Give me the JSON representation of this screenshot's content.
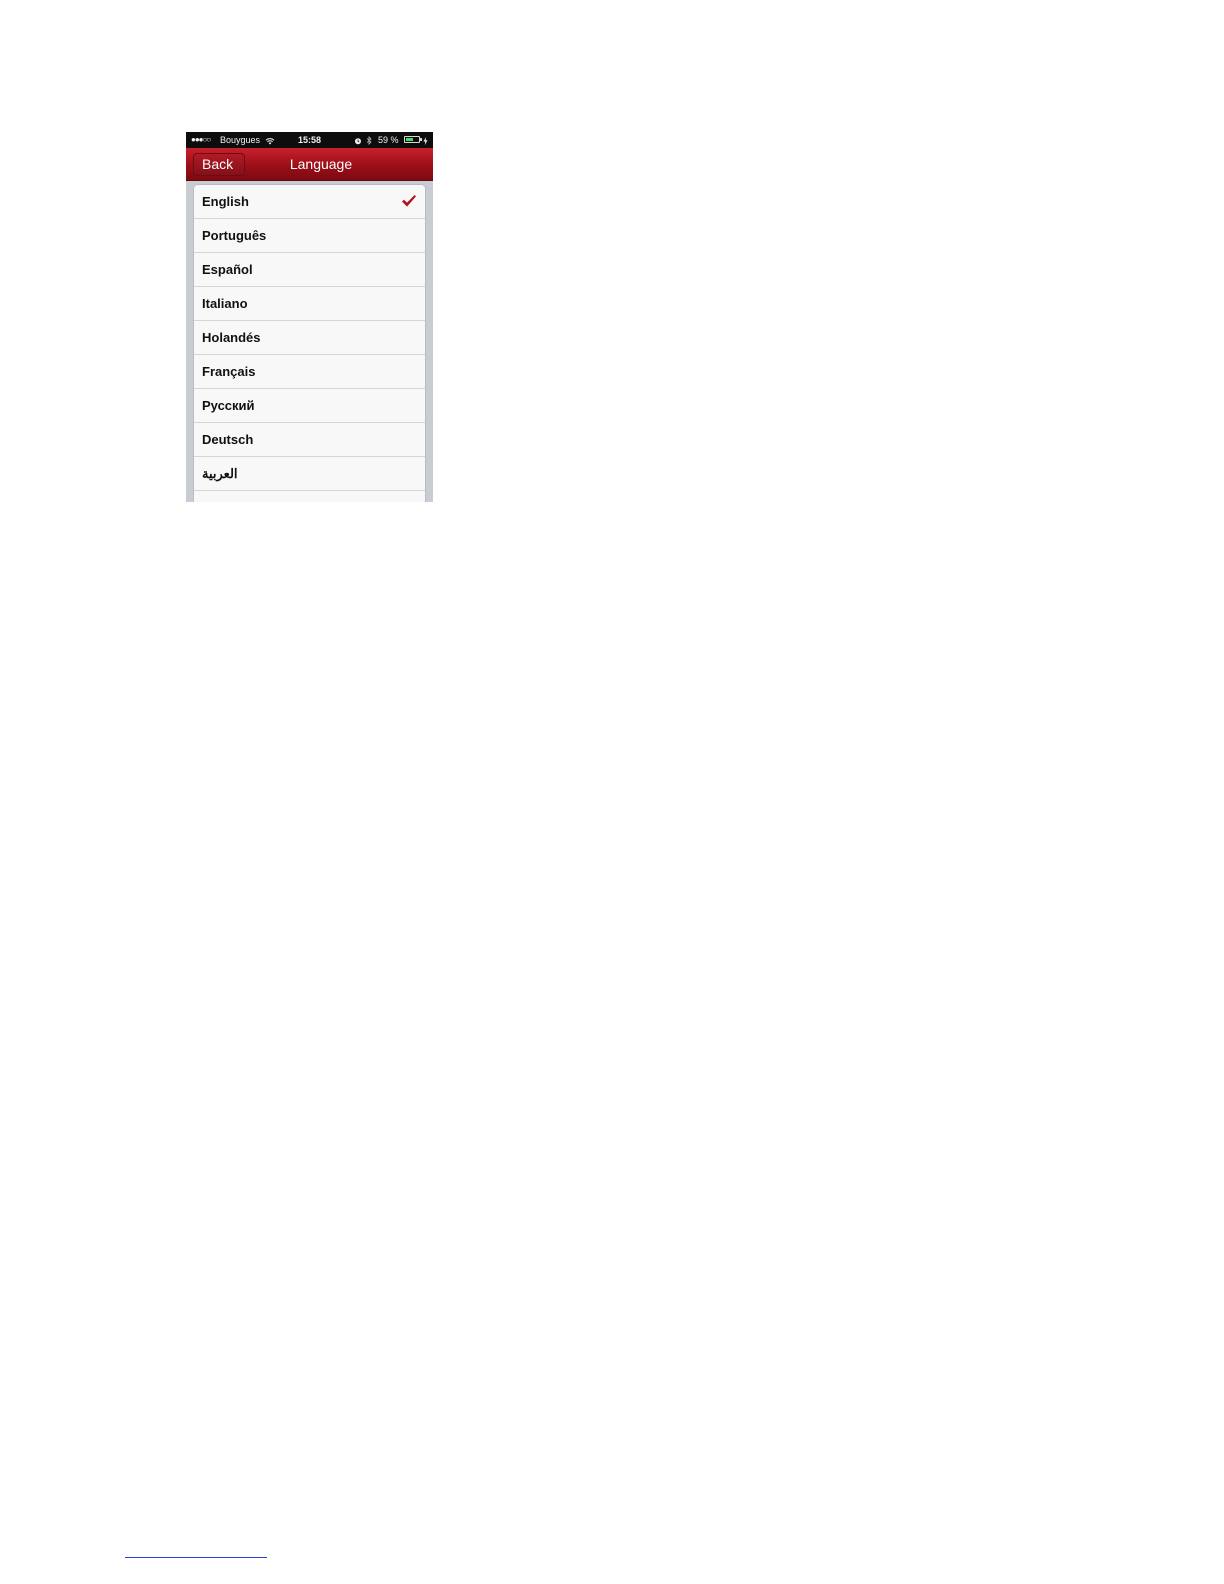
{
  "status_bar": {
    "signal": "●●●○○",
    "carrier": "Bouygues",
    "time": "15:58",
    "battery_percent": "59 %",
    "battery_level": 0.59
  },
  "nav": {
    "back_label": "Back",
    "title": "Language"
  },
  "languages": [
    {
      "label": "English",
      "selected": true
    },
    {
      "label": "Português",
      "selected": false
    },
    {
      "label": "Español",
      "selected": false
    },
    {
      "label": "Italiano",
      "selected": false
    },
    {
      "label": "Holandés",
      "selected": false
    },
    {
      "label": "Français",
      "selected": false
    },
    {
      "label": "Русский",
      "selected": false
    },
    {
      "label": "Deutsch",
      "selected": false
    },
    {
      "label": "العربية",
      "selected": false
    }
  ],
  "colors": {
    "nav_red": "#9b0f18",
    "checkmark": "#b3121f",
    "battery_green": "#4cd964"
  }
}
